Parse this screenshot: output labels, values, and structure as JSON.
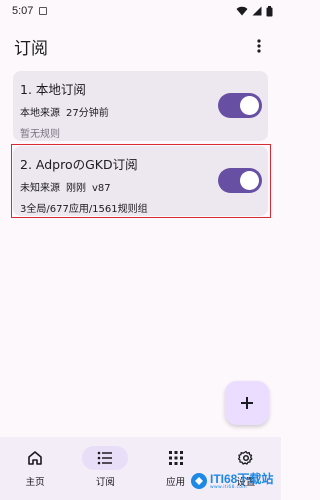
{
  "status_bar": {
    "time": "5:07"
  },
  "app_bar": {
    "title": "订阅"
  },
  "subscriptions": [
    {
      "title": "1. 本地订阅",
      "source": "本地来源",
      "updated": "27分钟前",
      "version": "",
      "detail": "暂无规则",
      "enabled": true
    },
    {
      "title": "2. AdproのGKD订阅",
      "source": "未知来源",
      "updated": "刚刚",
      "version": "v87",
      "detail": "3全局/677应用/1561规则组",
      "enabled": true
    }
  ],
  "fab": {
    "icon": "plus-icon"
  },
  "bottom_nav": {
    "items": [
      {
        "label": "主页",
        "icon": "home-icon",
        "active": false
      },
      {
        "label": "订阅",
        "icon": "list-icon",
        "active": true
      },
      {
        "label": "应用",
        "icon": "grid-icon",
        "active": false
      },
      {
        "label": "设置",
        "icon": "gear-icon",
        "active": false
      }
    ]
  },
  "watermark": {
    "brand": "ITI68下载站",
    "sub": "www.iti68.com"
  },
  "colors": {
    "accent": "#6750a4",
    "card": "#ede7f0",
    "highlight": "#d92b34",
    "fab": "#eaddff"
  }
}
